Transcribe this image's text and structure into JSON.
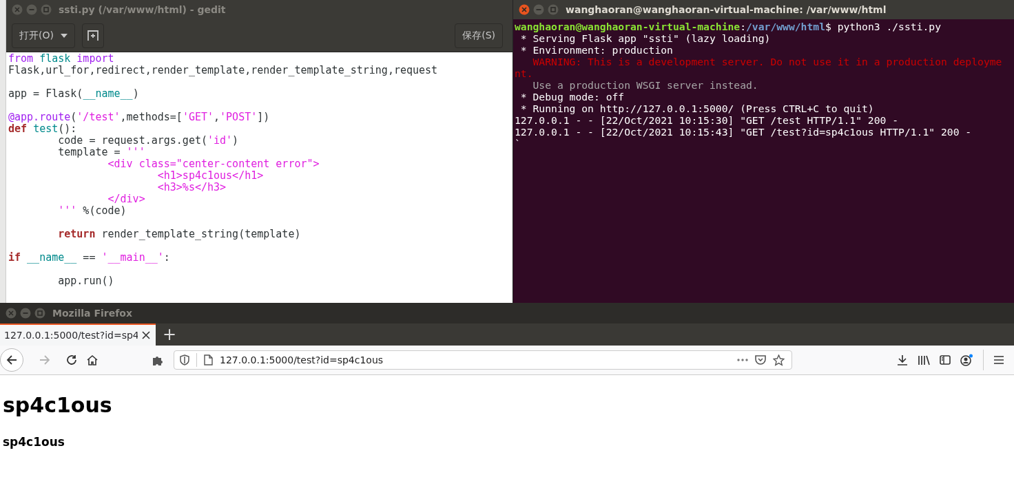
{
  "editor": {
    "title": "ssti.py (/var/www/html) - gedit",
    "active": false,
    "open_button": "打开(O)",
    "save_button": "保存(S)",
    "lines": [
      {
        "kind": "code",
        "tokens": [
          {
            "kind": "keyword",
            "text": "from "
          },
          {
            "kind": "name",
            "text": "flask "
          },
          {
            "kind": "keyword",
            "text": "import"
          }
        ]
      },
      {
        "kind": "code",
        "tokens": [
          {
            "kind": "plain",
            "text": "Flask,url_for,redirect,render_template,render_template_string,request"
          }
        ]
      },
      {
        "kind": "blank"
      },
      {
        "kind": "code",
        "tokens": [
          {
            "kind": "plain",
            "text": "app = Flask("
          },
          {
            "kind": "name",
            "text": "__name__"
          },
          {
            "kind": "plain",
            "text": ")"
          }
        ]
      },
      {
        "kind": "blank"
      },
      {
        "kind": "code",
        "tokens": [
          {
            "kind": "keyword",
            "text": "@app.route"
          },
          {
            "kind": "plain",
            "text": "("
          },
          {
            "kind": "string",
            "text": "'/test'"
          },
          {
            "kind": "plain",
            "text": ",methods=["
          },
          {
            "kind": "string",
            "text": "'GET'"
          },
          {
            "kind": "plain",
            "text": ","
          },
          {
            "kind": "string",
            "text": "'POST'"
          },
          {
            "kind": "plain",
            "text": "])"
          }
        ]
      },
      {
        "kind": "code",
        "tokens": [
          {
            "kind": "statement",
            "text": "def "
          },
          {
            "kind": "name",
            "text": "test"
          },
          {
            "kind": "plain",
            "text": "():"
          }
        ]
      },
      {
        "kind": "code",
        "tokens": [
          {
            "kind": "plain",
            "text": "        code = request.args.get("
          },
          {
            "kind": "string",
            "text": "'id'"
          },
          {
            "kind": "plain",
            "text": ")"
          }
        ]
      },
      {
        "kind": "code",
        "tokens": [
          {
            "kind": "plain",
            "text": "        template = "
          },
          {
            "kind": "string",
            "text": "'''"
          }
        ]
      },
      {
        "kind": "code",
        "tokens": [
          {
            "kind": "string",
            "text": "                <div class=\"center-content error\">"
          }
        ]
      },
      {
        "kind": "code",
        "tokens": [
          {
            "kind": "string",
            "text": "                        <h1>sp4c1ous</h1>"
          }
        ]
      },
      {
        "kind": "code",
        "tokens": [
          {
            "kind": "string",
            "text": "                        <h3>%s</h3>"
          }
        ]
      },
      {
        "kind": "code",
        "tokens": [
          {
            "kind": "string",
            "text": "                </div>"
          }
        ]
      },
      {
        "kind": "code",
        "tokens": [
          {
            "kind": "string",
            "text": "        '''"
          },
          {
            "kind": "plain",
            "text": " %(code)"
          }
        ]
      },
      {
        "kind": "blank"
      },
      {
        "kind": "code",
        "tokens": [
          {
            "kind": "statement",
            "text": "        return"
          },
          {
            "kind": "plain",
            "text": " render_template_string(template)"
          }
        ]
      },
      {
        "kind": "blank"
      },
      {
        "kind": "code",
        "tokens": [
          {
            "kind": "statement",
            "text": "if "
          },
          {
            "kind": "name",
            "text": "__name__"
          },
          {
            "kind": "plain",
            "text": " == "
          },
          {
            "kind": "string",
            "text": "'__main__'"
          },
          {
            "kind": "plain",
            "text": ":"
          }
        ]
      },
      {
        "kind": "blank"
      },
      {
        "kind": "code",
        "tokens": [
          {
            "kind": "plain",
            "text": "        app.run()"
          }
        ]
      }
    ]
  },
  "terminal": {
    "title": "wanghaoran@wanghaoran-virtual-machine: /var/www/html",
    "active": true,
    "lines": [
      [
        {
          "kind": "user",
          "text": "wanghaoran@wanghaoran-virtual-machine"
        },
        {
          "kind": "plain",
          "text": ":"
        },
        {
          "kind": "path",
          "text": "/var/www/html"
        },
        {
          "kind": "plain",
          "text": "$ python3 ./ssti.py"
        }
      ],
      [
        {
          "kind": "plain",
          "text": " * Serving Flask app \"ssti\" (lazy loading)"
        }
      ],
      [
        {
          "kind": "plain",
          "text": " * Environment: production"
        }
      ],
      [
        {
          "kind": "warning",
          "text": "   WARNING: This is a development server. Do not use it in a production deployme"
        }
      ],
      [
        {
          "kind": "warning",
          "text": "nt."
        }
      ],
      [
        {
          "kind": "dim",
          "text": "   Use a production WSGI server instead."
        }
      ],
      [
        {
          "kind": "plain",
          "text": " * Debug mode: off"
        }
      ],
      [
        {
          "kind": "plain",
          "text": " * Running on http://127.0.0.1:5000/ (Press CTRL+C to quit)"
        }
      ],
      [
        {
          "kind": "plain",
          "text": "127.0.0.1 - - [22/Oct/2021 10:15:30] \"GET /test HTTP/1.1\" 200 -"
        }
      ],
      [
        {
          "kind": "plain",
          "text": "127.0.0.1 - - [22/Oct/2021 10:15:43] \"GET /test?id=sp4c1ous HTTP/1.1\" 200 -"
        }
      ],
      [
        {
          "kind": "plain",
          "text": "`"
        }
      ]
    ]
  },
  "browser": {
    "title": "Mozilla Firefox",
    "active": false,
    "tabs": [
      {
        "label": "127.0.0.1:5000/test?id=sp4",
        "selected": true
      }
    ],
    "new_tab": "+",
    "forward_disabled": true,
    "url": "127.0.0.1:5000/test?id=sp4c1ous",
    "page_heading": "sp4c1ous",
    "page_subheading": "sp4c1ous"
  }
}
